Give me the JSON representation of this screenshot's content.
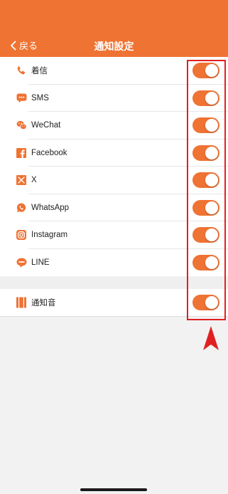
{
  "header": {
    "back_label": "戻る",
    "title": "通知設定",
    "background": "#ef7333"
  },
  "apps": [
    {
      "label": "着信",
      "icon": "phone-icon",
      "enabled": true
    },
    {
      "label": "SMS",
      "icon": "sms-icon",
      "enabled": true
    },
    {
      "label": "WeChat",
      "icon": "wechat-icon",
      "enabled": true
    },
    {
      "label": "Facebook",
      "icon": "facebook-icon",
      "enabled": true
    },
    {
      "label": "X",
      "icon": "x-icon",
      "enabled": true
    },
    {
      "label": "WhatsApp",
      "icon": "whatsapp-icon",
      "enabled": true
    },
    {
      "label": "Instagram",
      "icon": "instagram-icon",
      "enabled": true
    },
    {
      "label": "LINE",
      "icon": "line-icon",
      "enabled": true
    }
  ],
  "sound": {
    "label": "通知音",
    "icon": "sound-icon",
    "enabled": true
  },
  "colors": {
    "accent": "#ef7333",
    "annotation": "#e02020"
  }
}
